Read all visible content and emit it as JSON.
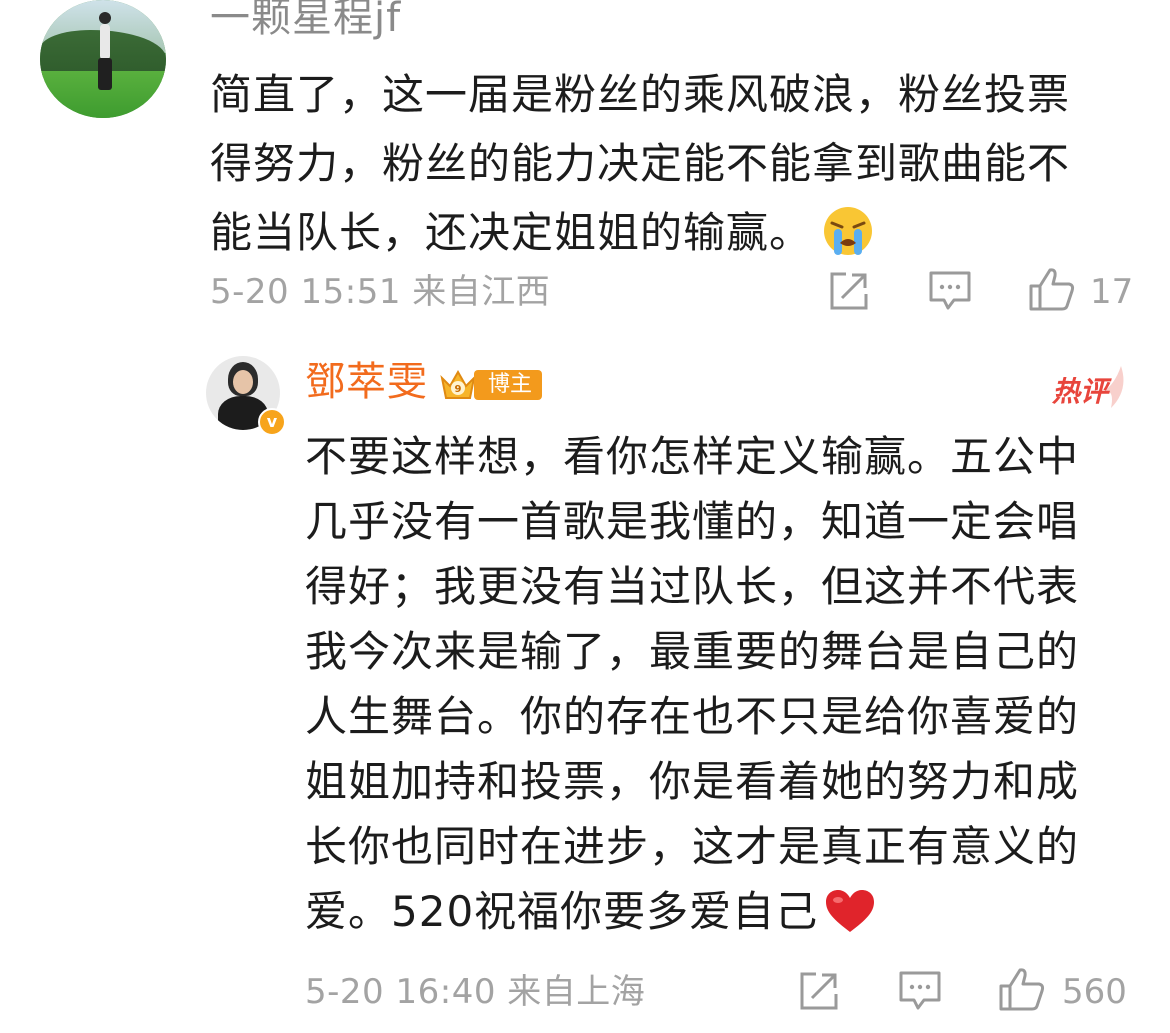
{
  "comment": {
    "username": "一颗星程jf",
    "lines": [
      "简直了，这一届是粉丝的乘风破浪，粉丝投票",
      "得努力，粉丝的能力决定能不能拿到歌曲能不",
      "能当队长，还决定姐姐的输赢。"
    ],
    "emoji": "crying-face-emoji",
    "meta": "5-20 15:51 来自江西",
    "like_count": "17"
  },
  "reply": {
    "username": "鄧萃雯",
    "badge_label": "博主",
    "hot_label": "热评",
    "lines": [
      "不要这样想，看你怎样定义输赢。五公中",
      "几乎没有一首歌是我懂的，知道一定会唱",
      "得好；我更没有当过队长，但这并不代表",
      "我今次来是输了，最重要的舞台是自己的",
      "人生舞台。你的存在也不只是给你喜爱的",
      "姐姐加持和投票，你是看着她的努力和成",
      "长你也同时在进步，这才是真正有意义的",
      "爱。520祝福你要多爱自己"
    ],
    "emoji": "red-heart-emoji",
    "meta": "5-20 16:40 来自上海",
    "like_count": "560"
  },
  "icons": [
    "share-icon",
    "comment-icon",
    "like-icon",
    "verified-v-icon",
    "crown-badge-icon"
  ],
  "colors": {
    "username_reply": "#f26b1d",
    "meta_gray": "#a3a3a3",
    "hot_red": "#e8453c",
    "badge_orange": "#f39a1c"
  }
}
